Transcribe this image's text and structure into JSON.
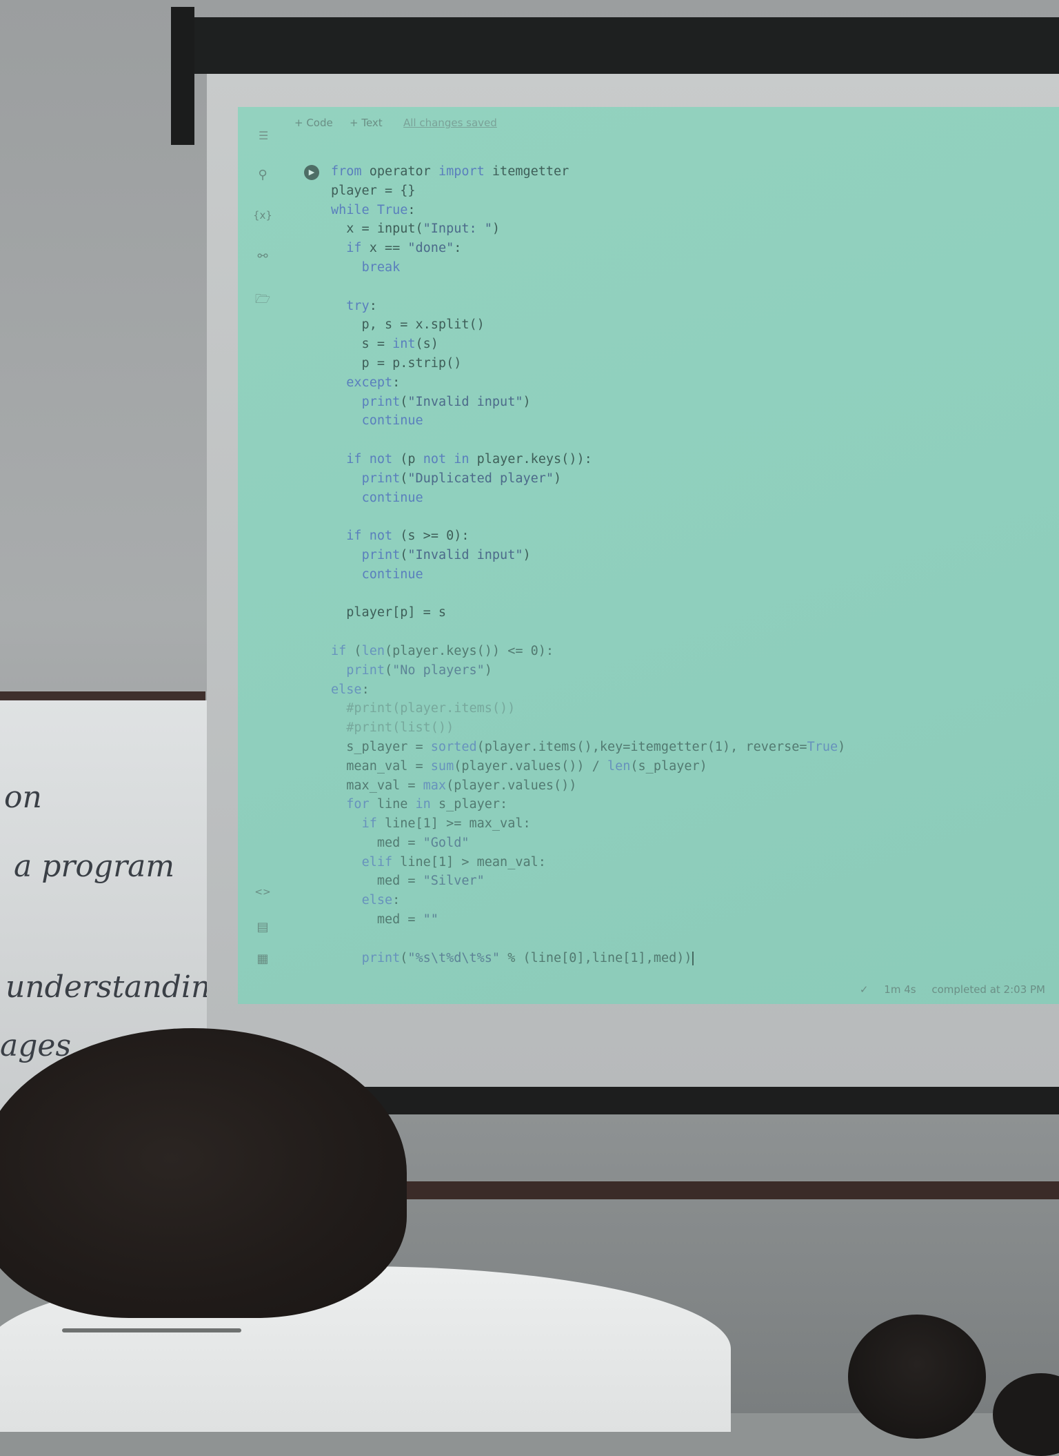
{
  "toolbar": {
    "code_label": "+ Code",
    "text_label": "+ Text",
    "saved_label": "All changes saved"
  },
  "sidebar": {
    "menu_icon": "menu-icon",
    "icons": [
      "search-icon",
      "variables-icon",
      "key-icon",
      "folder-icon"
    ],
    "bottom_icons": [
      "code-snippets-icon",
      "command-palette-icon",
      "terminal-icon"
    ]
  },
  "cell": {
    "run_icon": "play-icon",
    "code_lines": [
      "from operator import itemgetter",
      "player = {}",
      "while True:",
      "  x = input(\"Input: \")",
      "  if x == \"done\":",
      "    break",
      "",
      "  try:",
      "    p, s = x.split()",
      "    s = int(s)",
      "    p = p.strip()",
      "  except:",
      "    print(\"Invalid input\")",
      "    continue",
      "",
      "  if not (p not in player.keys()):",
      "    print(\"Duplicated player\")",
      "    continue",
      "",
      "  if not (s >= 0):",
      "    print(\"Invalid input\")",
      "    continue",
      "",
      "  player[p] = s",
      "",
      "if (len(player.keys()) <= 0):",
      "  print(\"No players\")",
      "else:",
      "  #print(player.items())",
      "  #print(list())",
      "  s_player = sorted(player.items(),key=itemgetter(1), reverse=True)",
      "  mean_val = sum(player.values()) / len(s_player)",
      "  max_val = max(player.values())",
      "  for line in s_player:",
      "    if line[1] >= max_val:",
      "      med = \"Gold\"",
      "    elif line[1] > mean_val:",
      "      med = \"Silver\"",
      "    else:",
      "      med = \"\"",
      "",
      "    print(\"%s\\t%d\\t%s\" % (line[0],line[1],med))"
    ]
  },
  "status": {
    "check_icon": "check-icon",
    "duration": "1m 4s",
    "completed": "completed at 2:03 PM"
  },
  "whiteboard": {
    "lines": [
      "on",
      "a program",
      "understanding",
      "ages"
    ]
  }
}
